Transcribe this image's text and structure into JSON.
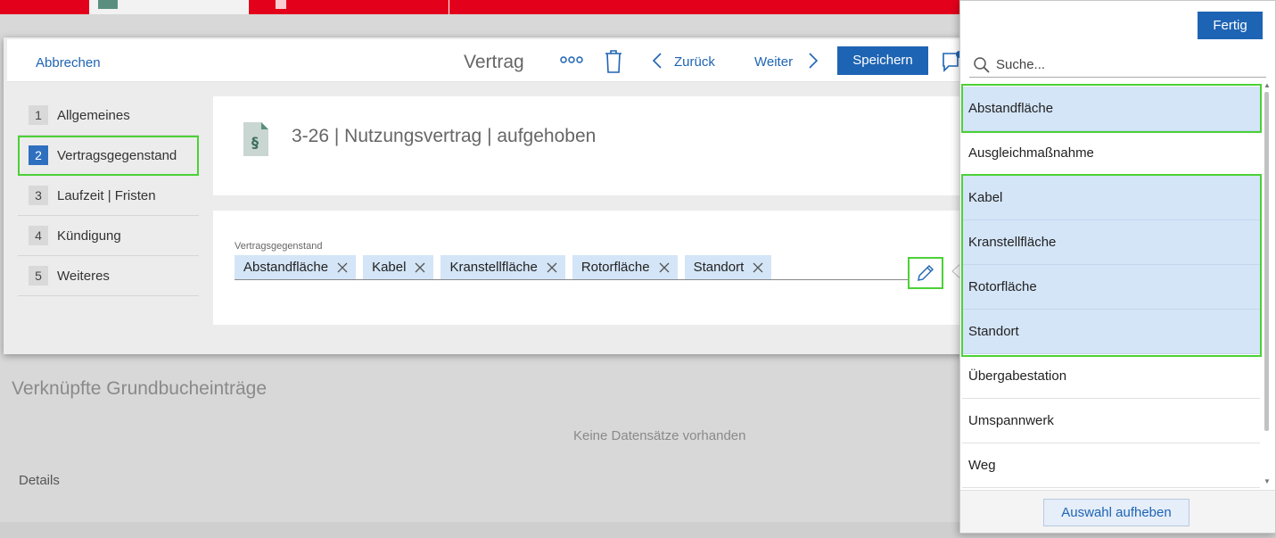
{
  "dialog": {
    "cancel_label": "Abbrechen",
    "title": "Vertrag",
    "back_label": "Zurück",
    "next_label": "Weiter",
    "save_label": "Speichern"
  },
  "nav": {
    "items": [
      {
        "num": "1",
        "label": "Allgemeines"
      },
      {
        "num": "2",
        "label": "Vertragsgegenstand",
        "active": true
      },
      {
        "num": "3",
        "label": "Laufzeit | Fristen"
      },
      {
        "num": "4",
        "label": "Kündigung"
      },
      {
        "num": "5",
        "label": "Weiteres"
      }
    ]
  },
  "contract": {
    "title": "3-26 | Nutzungsvertrag | aufgehoben"
  },
  "field": {
    "label": "Vertragsgegenstand",
    "chips": [
      "Abstandfläche",
      "Kabel",
      "Kranstellfläche",
      "Rotorfläche",
      "Standort"
    ]
  },
  "background": {
    "linked_title": "Verknüpfte Grundbucheinträge",
    "no_records": "Keine Datensätze vorhanden",
    "details": "Details"
  },
  "panel": {
    "done_label": "Fertig",
    "search_placeholder": "Suche...",
    "options": [
      {
        "label": "Abstandfläche",
        "selected": true
      },
      {
        "label": "Ausgleichmaßnahme",
        "selected": false
      },
      {
        "label": "Kabel",
        "selected": true
      },
      {
        "label": "Kranstellfläche",
        "selected": true
      },
      {
        "label": "Rotorfläche",
        "selected": true
      },
      {
        "label": "Standort",
        "selected": true
      },
      {
        "label": "Übergabestation",
        "selected": false
      },
      {
        "label": "Umspannwerk",
        "selected": false
      },
      {
        "label": "Weg",
        "selected": false
      }
    ],
    "clear_label": "Auswahl aufheben"
  },
  "colors": {
    "accent": "#1e64b4",
    "top_bar": "#e3001b",
    "chip_bg": "#d4e5f7",
    "highlight": "#4cd137"
  }
}
